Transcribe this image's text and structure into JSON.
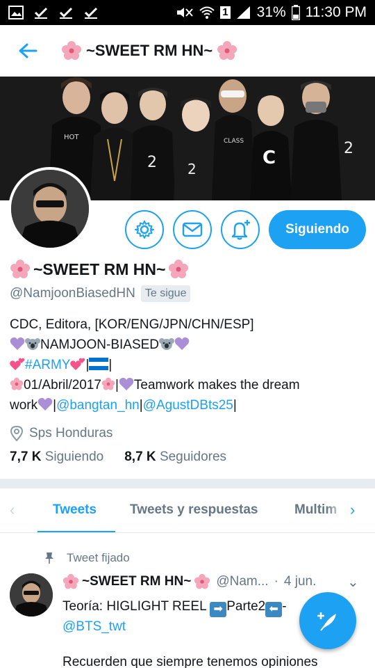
{
  "status_bar": {
    "battery_percent": "31%",
    "time": "11:30 PM",
    "sim_label": "1"
  },
  "app_bar": {
    "title": "~SWEET RM HN~"
  },
  "profile": {
    "display_name": "~SWEET RM HN~",
    "handle": "@NamjoonBiasedHN",
    "follows_you": "Te sigue",
    "follow_button": "Siguiendo",
    "bio": {
      "line1": "CDC, Editora, [KOR/ENG/JPN/CHN/ESP]",
      "line2_text": "NAMJOON-BIASED",
      "line3_hashtag": "#ARMY",
      "line3_sep": "|",
      "line4_date": "01/Abril/2017",
      "line4_sep": "|",
      "line4_text": "Teamwork makes the dream",
      "line5_text": "work",
      "line5_sep1": "|",
      "mention1": "@bangtan_hn",
      "line5_sep2": "|",
      "mention2": "@AgustDBts25",
      "line5_sep3": "|"
    },
    "location": "Sps Honduras",
    "following_count": "7,7 K",
    "following_label": "Siguiendo",
    "followers_count": "8,7 K",
    "followers_label": "Seguidores"
  },
  "tabs": [
    {
      "label": "Tweets",
      "active": true
    },
    {
      "label": "Tweets y respuestas",
      "active": false
    },
    {
      "label": "Multim",
      "active": false
    }
  ],
  "tweet": {
    "pinned_label": "Tweet fijado",
    "author_name": "~SWEET RM HN~",
    "author_handle": "@Nam...",
    "sep": "·",
    "date": "4 jun.",
    "text_start": "Teoría: HIGLIGHT REEL ",
    "text_mid": "Parte2",
    "text_end": "-",
    "mention": "@BTS_twt",
    "text_line2": "Recuerden que siempre tenemos opiniones"
  },
  "colors": {
    "accent": "#1da1f2",
    "muted": "#657786",
    "text": "#14171a"
  },
  "icons": {
    "back": "arrow-left-icon",
    "settings": "gear-icon",
    "message": "envelope-icon",
    "notifications": "bell-plus-icon",
    "location": "map-pin-icon",
    "pin": "pin-icon",
    "compose": "feather-plus-icon"
  }
}
